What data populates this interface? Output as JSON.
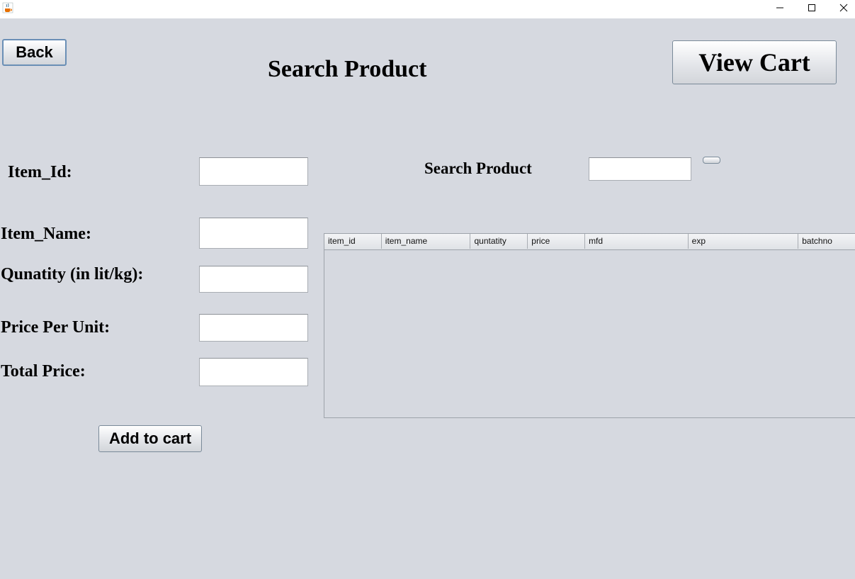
{
  "window": {
    "app_icon": "java-cup-icon",
    "controls": [
      "minimize-icon",
      "maximize-icon",
      "close-icon"
    ]
  },
  "header": {
    "back_label": "Back",
    "title": "Search Product",
    "view_cart_label": "View Cart"
  },
  "form": {
    "item_id_label": "Item_Id:",
    "item_id_value": "",
    "item_name_label": "Item_Name:",
    "item_name_value": "",
    "quantity_label": "Qunatity (in lit/kg):",
    "quantity_value": "",
    "price_label": "Price Per Unit:",
    "price_value": "",
    "total_label": "Total Price:",
    "total_value": "",
    "add_to_cart_label": "Add to cart"
  },
  "search": {
    "label": "Search Product",
    "value": "",
    "button_label": ""
  },
  "table": {
    "columns": [
      "item_id",
      "item_name",
      "quntatity",
      "price",
      "mfd",
      "exp",
      "batchno"
    ],
    "rows": []
  }
}
